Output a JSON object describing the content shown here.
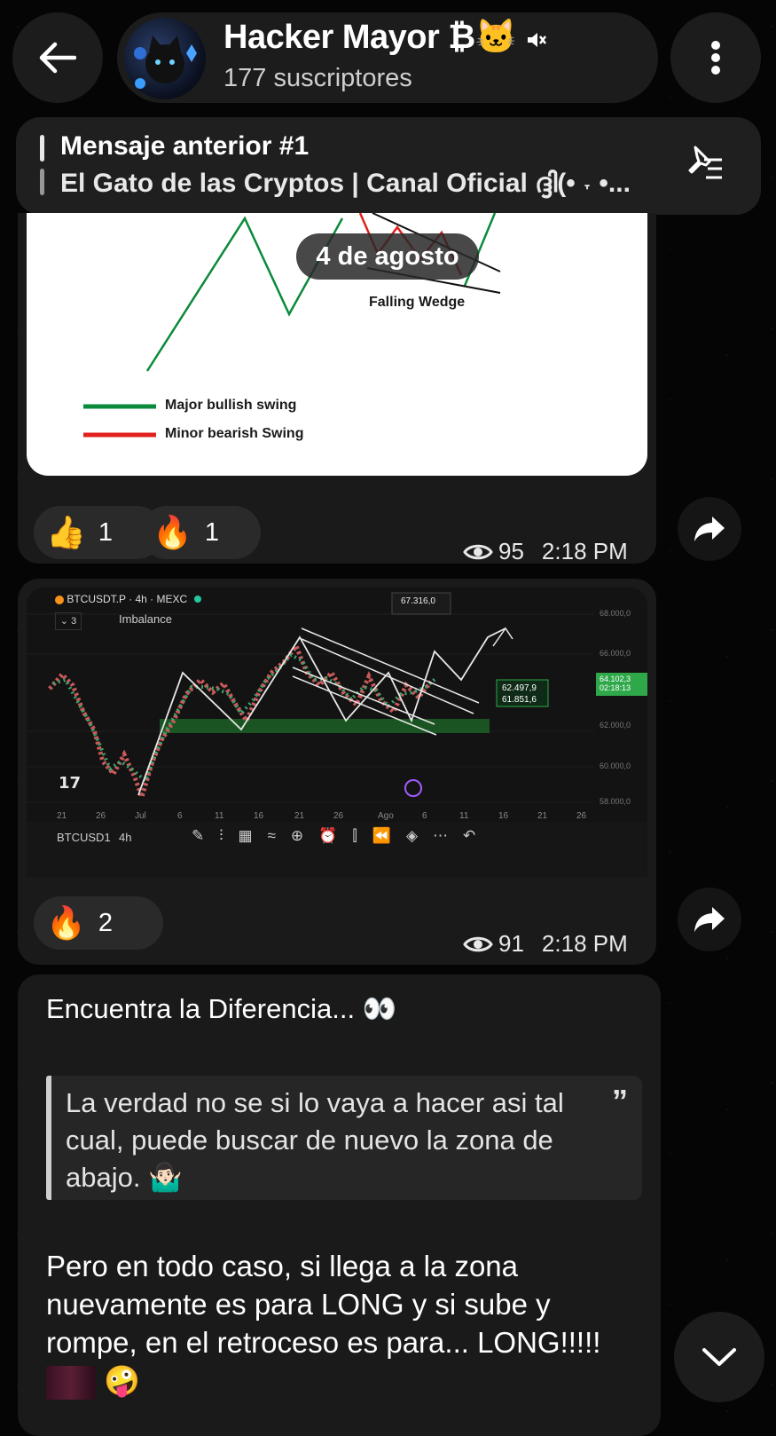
{
  "header": {
    "channel_name": "Hacker Mayor ₿🐱",
    "subscribers": "177 suscriptores"
  },
  "pinned": {
    "title": "Mensaje anterior #1",
    "text": "El Gato de las Cryptos | Canal Oficial ദ്ദി(• ˕ •..."
  },
  "date_separator": "4 de agosto",
  "message1": {
    "image": {
      "label_pattern": "Falling Wedge",
      "legend": [
        {
          "label": "Major bullish swing",
          "color": "#0a8a3a"
        },
        {
          "label": "Minor bearish Swing",
          "color": "#e0201c"
        }
      ]
    },
    "reactions": [
      {
        "emoji": "👍",
        "count": "1"
      },
      {
        "emoji": "🔥",
        "count": "1"
      }
    ],
    "views": "95",
    "time": "2:18 PM"
  },
  "message2": {
    "chart": {
      "symbol": "BTCUSDT.P · 4h · MEXC",
      "collapse_label": "3",
      "indicator": "Imbalance",
      "top_label": "67.316,0",
      "price_labels": [
        "62.497,9",
        "61.851,6"
      ],
      "y_ticks": [
        "68.000,0",
        "66.000,0",
        "64.102,3",
        "62.000,0",
        "60.000,0",
        "58.000,0"
      ],
      "countdown": "02:18:13",
      "x_ticks": [
        "21",
        "26",
        "Jul",
        "6",
        "11",
        "16",
        "21",
        "26",
        "Ago",
        "6",
        "11",
        "16",
        "21",
        "26"
      ],
      "toolbar_symbol": "BTCUSD1",
      "toolbar_interval": "4h"
    },
    "reactions": [
      {
        "emoji": "🔥",
        "count": "2"
      }
    ],
    "views": "91",
    "time": "2:18 PM"
  },
  "message3": {
    "title": "Encuentra la Diferencia... 👀",
    "quote": "La verdad no se si lo vaya a hacer asi tal cual, puede buscar de nuevo la zona de abajo. 🤷🏻‍♂️",
    "body": "Pero en todo caso, si llega a la zona nuevamente es para LONG y si sube y rompe, en el retroceso es para... LONG!!!!!",
    "body_emoji": "🤪"
  }
}
